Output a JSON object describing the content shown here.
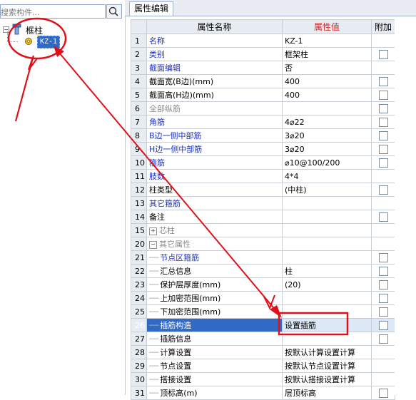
{
  "left_panel": {
    "search_placeholder": "搜索构件...",
    "tree_root_label": "框柱",
    "tree_root_expander": "−",
    "tree_child_label": "KZ-1"
  },
  "tab": {
    "label": "属性编辑"
  },
  "grid": {
    "headers": {
      "name": "属性名称",
      "value": "属性值",
      "extra": "附加"
    },
    "rows": [
      {
        "num": "1",
        "name": "名称",
        "value": "KZ-1",
        "cb": false,
        "style": "blue"
      },
      {
        "num": "2",
        "name": "类别",
        "value": "框架柱",
        "cb": true,
        "style": "blue"
      },
      {
        "num": "3",
        "name": "截面编辑",
        "value": "否",
        "cb": false,
        "style": "blue"
      },
      {
        "num": "4",
        "name": "截面宽(B边)(mm)",
        "value": "400",
        "cb": true,
        "style": "normal"
      },
      {
        "num": "5",
        "name": "截面高(H边)(mm)",
        "value": "400",
        "cb": true,
        "style": "normal"
      },
      {
        "num": "6",
        "name": "全部纵筋",
        "value": "",
        "cb": true,
        "style": "gray"
      },
      {
        "num": "7",
        "name": "角筋",
        "value": "4⌀22",
        "cb": true,
        "style": "blue"
      },
      {
        "num": "8",
        "name": "B边一侧中部筋",
        "value": "3⌀20",
        "cb": true,
        "style": "blue"
      },
      {
        "num": "9",
        "name": "H边一侧中部筋",
        "value": "3⌀20",
        "cb": true,
        "style": "blue"
      },
      {
        "num": "10",
        "name": "箍筋",
        "value": "⌀10@100/200",
        "cb": true,
        "style": "blue"
      },
      {
        "num": "11",
        "name": "肢数",
        "value": "4*4",
        "cb": false,
        "style": "blue"
      },
      {
        "num": "12",
        "name": "柱类型",
        "value": "(中柱)",
        "cb": true,
        "style": "normal"
      },
      {
        "num": "13",
        "name": "其它箍筋",
        "value": "",
        "cb": false,
        "style": "blue"
      },
      {
        "num": "14",
        "name": "备注",
        "value": "",
        "cb": true,
        "style": "normal"
      },
      {
        "num": "15",
        "name": "芯柱",
        "value": "",
        "cb": false,
        "style": "gray",
        "expander": "+"
      },
      {
        "num": "20",
        "name": "其它属性",
        "value": "",
        "cb": false,
        "style": "gray",
        "expander": "−"
      },
      {
        "num": "21",
        "name": "节点区箍筋",
        "value": "",
        "cb": true,
        "style": "blue",
        "child": true
      },
      {
        "num": "22",
        "name": "汇总信息",
        "value": "柱",
        "cb": true,
        "style": "normal",
        "child": true
      },
      {
        "num": "23",
        "name": "保护层厚度(mm)",
        "value": "(20)",
        "cb": true,
        "style": "normal",
        "child": true
      },
      {
        "num": "24",
        "name": "上加密范围(mm)",
        "value": "",
        "cb": true,
        "style": "normal",
        "child": true
      },
      {
        "num": "25",
        "name": "下加密范围(mm)",
        "value": "",
        "cb": true,
        "style": "normal",
        "child": true
      },
      {
        "num": "26",
        "name": "插筋构造",
        "value": "设置插筋",
        "cb": true,
        "style": "normal",
        "child": true,
        "selected": true
      },
      {
        "num": "27",
        "name": "插筋信息",
        "value": "",
        "cb": true,
        "style": "normal",
        "child": true
      },
      {
        "num": "28",
        "name": "计算设置",
        "value": "按默认计算设置计算",
        "cb": false,
        "style": "normal",
        "child": true
      },
      {
        "num": "29",
        "name": "节点设置",
        "value": "按默认节点设置计算",
        "cb": false,
        "style": "normal",
        "child": true
      },
      {
        "num": "30",
        "name": "搭接设置",
        "value": "按默认搭接设置计算",
        "cb": false,
        "style": "normal",
        "child": true
      },
      {
        "num": "31",
        "name": "顶标高(m)",
        "value": "层顶标高",
        "cb": true,
        "style": "normal",
        "child": true
      }
    ]
  },
  "colors": {
    "annotation": "#e0101a",
    "selection": "#316ac5",
    "link_blue": "#1c2fc8"
  }
}
